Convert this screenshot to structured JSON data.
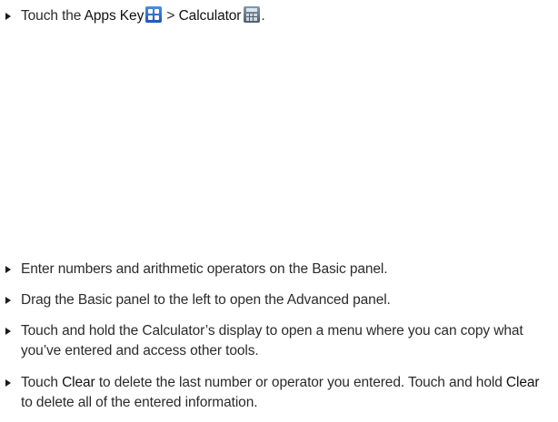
{
  "step1": {
    "prefix": "Touch the ",
    "apps_key": "Apps Key",
    "separator": " > ",
    "calculator": "Calculator",
    "suffix": ".",
    "apps_icon": "apps-grid-icon",
    "calculator_icon": "calculator-icon"
  },
  "steps": [
    {
      "text": "Enter numbers and arithmetic operators on the Basic panel."
    },
    {
      "text": "Drag the Basic panel to the left to open the Advanced panel."
    },
    {
      "text": "Touch and hold the Calculator’s display to open a menu where you can copy what you’ve entered and access other tools."
    }
  ],
  "step_clear": {
    "part1": "Touch ",
    "clear1": "Clear",
    "part2": " to delete the last number or operator you entered. Touch and hold ",
    "clear2": "Clear",
    "part3": " to delete all of the entered information."
  }
}
